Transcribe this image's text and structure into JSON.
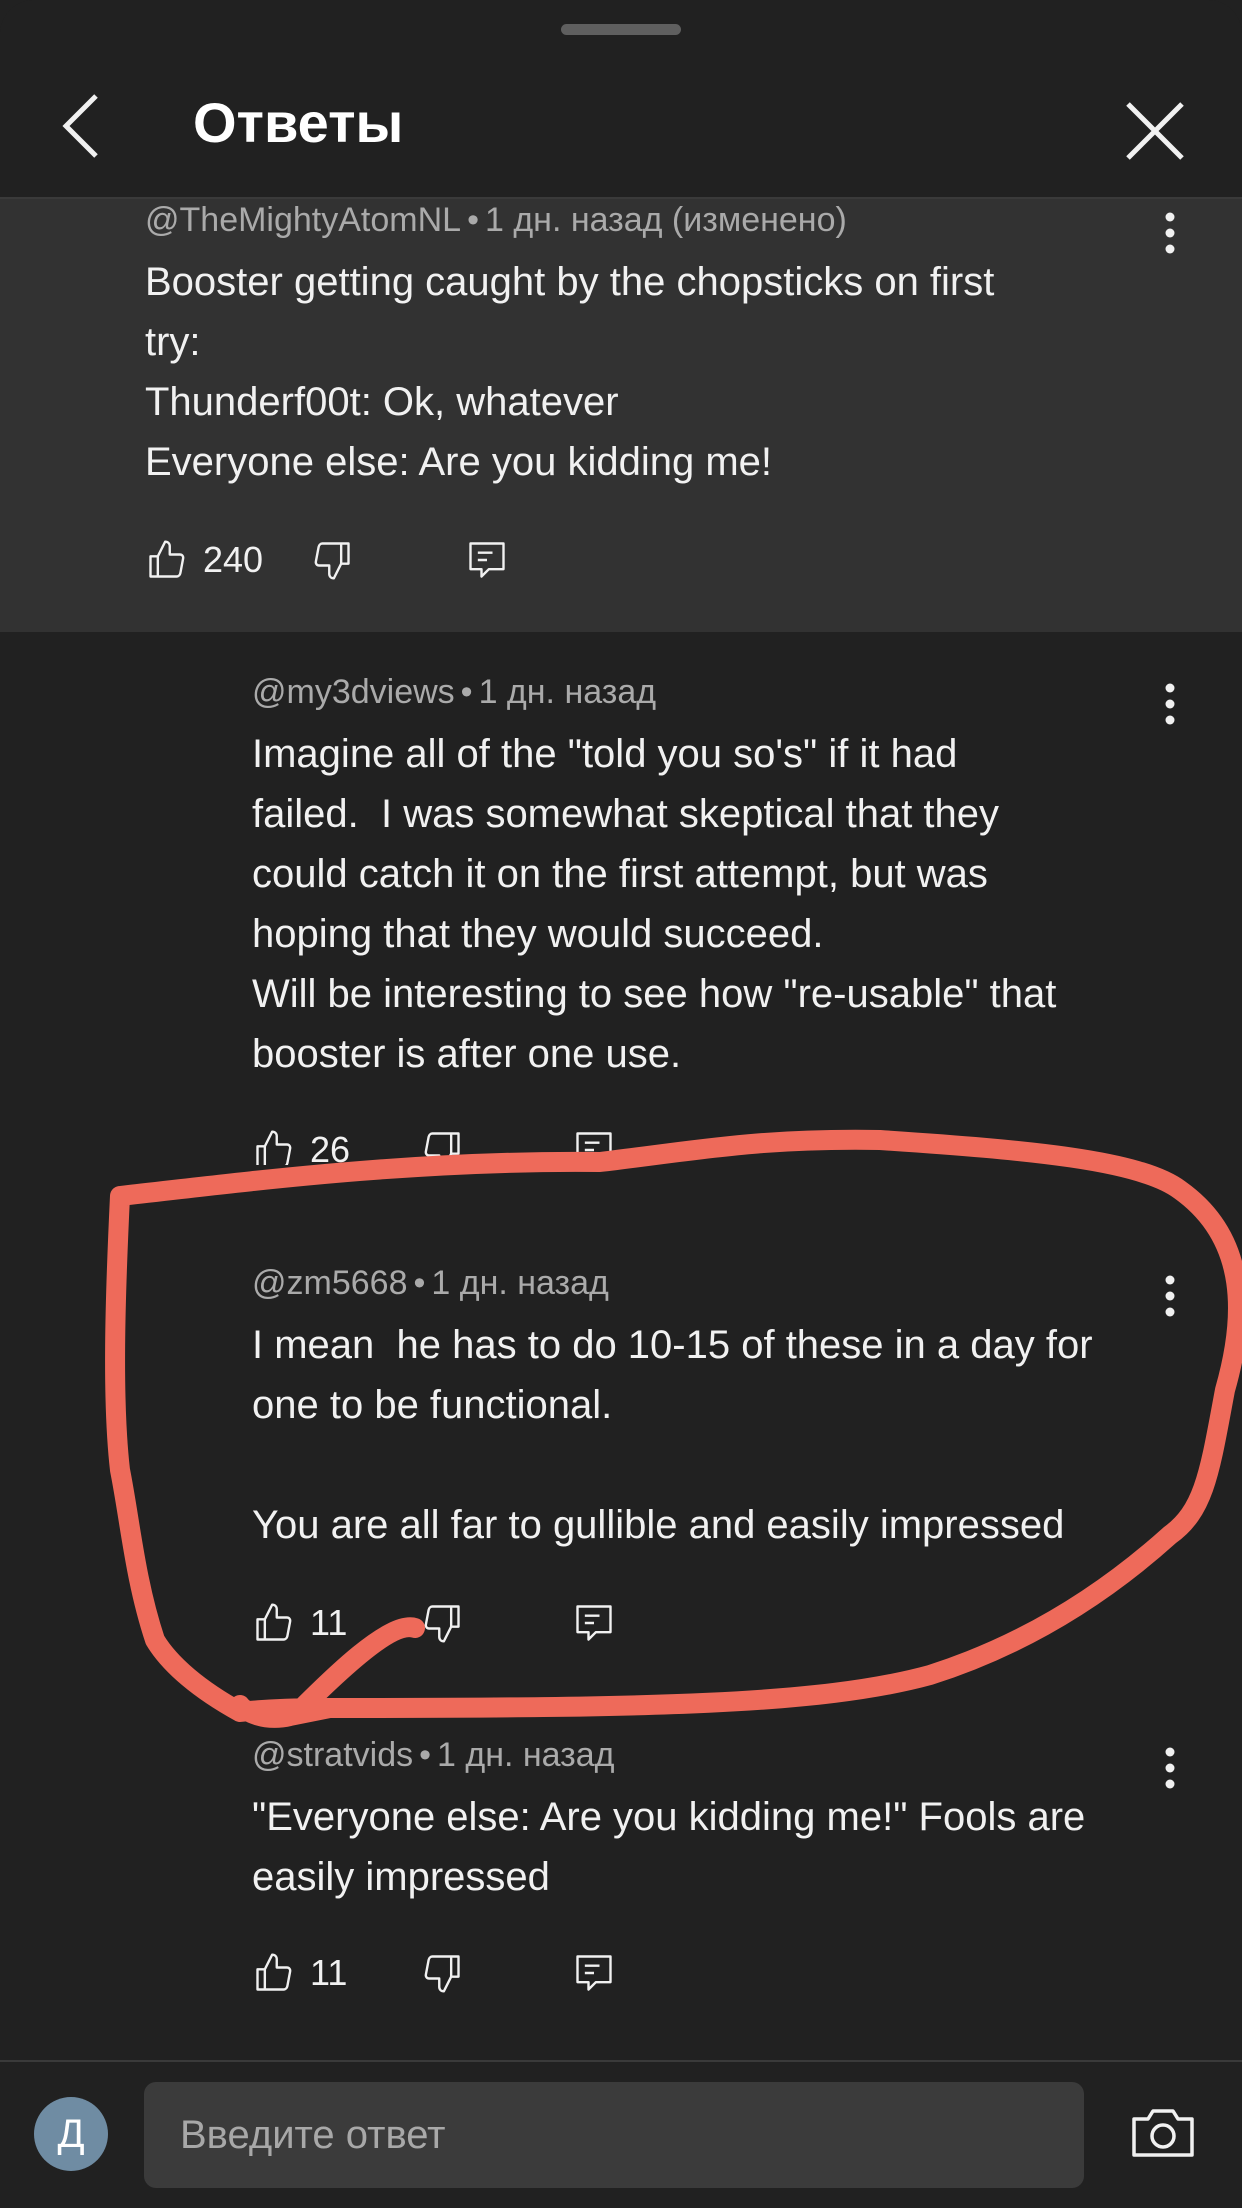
{
  "header": {
    "title": "Ответы"
  },
  "comments": [
    {
      "author": "@TheMightyAtomNL",
      "time": "1 дн. назад (изменено)",
      "text": "Booster getting caught by the chopsticks on first\ntry:\nThunderf00t: Ok, whatever\nEveryone else: Are you kidding me!",
      "likes": "240"
    },
    {
      "author": "@my3dviews",
      "time": "1 дн. назад",
      "text": "Imagine all of the \"told you so's\" if it had\nfailed.  I was somewhat skeptical that they\ncould catch it on the first attempt, but was\nhoping that they would succeed.\nWill be interesting to see how \"re-usable\" that\nbooster is after one use.",
      "likes": "26"
    },
    {
      "author": "@zm5668",
      "time": "1 дн. назад",
      "text": "I mean  he has to do 10-15 of these in a day for\none to be functional.\n\nYou are all far to gullible and easily impressed",
      "likes": "11"
    },
    {
      "author": "@stratvids",
      "time": "1 дн. назад",
      "text": "\"Everyone else: Are you kidding me!\" Fools are\neasily impressed",
      "likes": "11"
    }
  ],
  "footer": {
    "avatar_letter": "Д",
    "reply_placeholder": "Введите ответ"
  },
  "colors": {
    "background": "#212121",
    "parent_background": "#323232",
    "annotation": "#ee6a5a"
  }
}
